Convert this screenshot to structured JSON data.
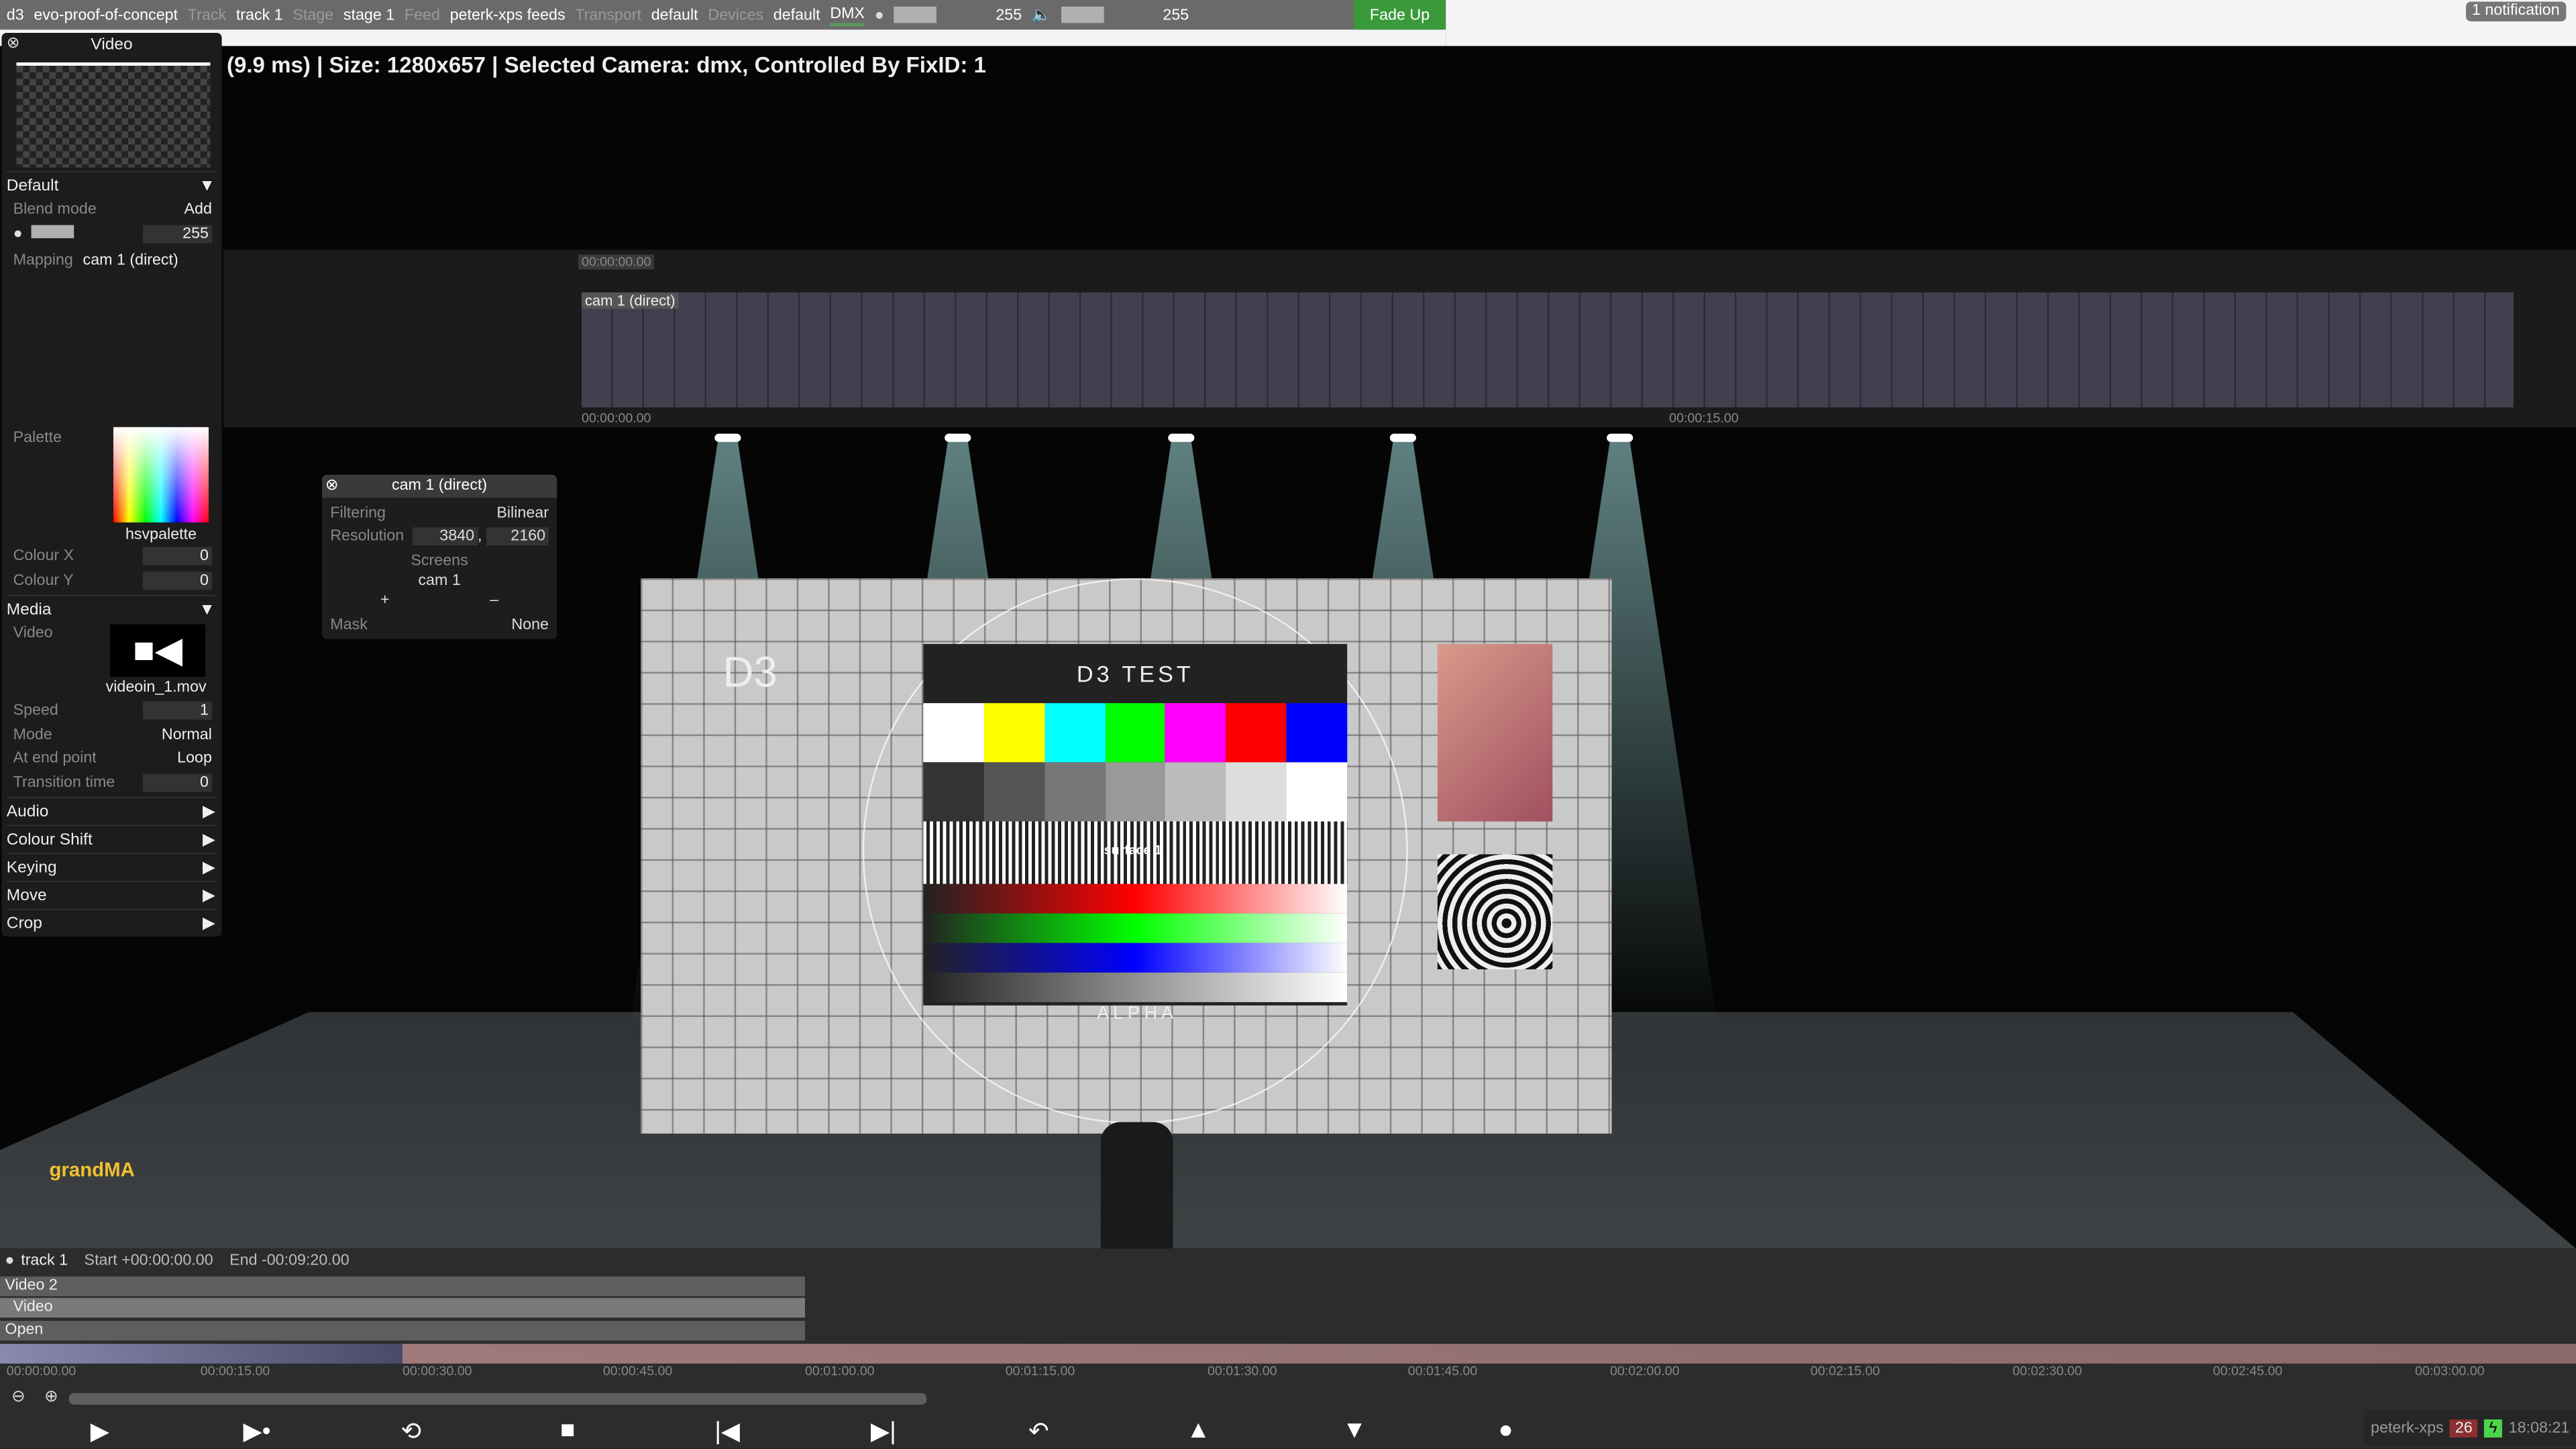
{
  "topbar": {
    "app": "d3",
    "project": "evo-proof-of-concept",
    "track_label": "Track",
    "track": "track 1",
    "stage_label": "Stage",
    "stage": "stage 1",
    "feed_label": "Feed",
    "feed": "peterk-xps feeds",
    "transport_label": "Transport",
    "transport": "default",
    "devices_label": "Devices",
    "devices": "default",
    "dmx": "DMX",
    "brightness": "255",
    "volume": "255",
    "fade_up": "Fade Up",
    "notification": "1 notification"
  },
  "status": "(9.9 ms) | Size: 1280x657 | Selected Camera:  dmx, Controlled By FixID: 1",
  "left_panel": {
    "title": "Video",
    "default_section": "Default",
    "blend_mode_label": "Blend mode",
    "blend_mode": "Add",
    "intensity": "255",
    "mapping_label": "Mapping",
    "mapping": "cam 1 (direct)",
    "palette_label": "Palette",
    "palette": "hsvpalette",
    "colour_x_label": "Colour X",
    "colour_x": "0",
    "colour_y_label": "Colour Y",
    "colour_y": "0",
    "media_section": "Media",
    "video_label": "Video",
    "video_file": "videoin_1.mov",
    "speed_label": "Speed",
    "speed": "1",
    "mode_label": "Mode",
    "mode": "Normal",
    "end_label": "At end point",
    "end": "Loop",
    "transition_label": "Transition time",
    "transition": "0",
    "sections": [
      "Audio",
      "Colour Shift",
      "Keying",
      "Move",
      "Crop"
    ]
  },
  "timeline": {
    "playhead": "00:00:00.00",
    "clip": "cam 1 (direct)",
    "start": "00:00:00.00",
    "mark": "00:00:15.00"
  },
  "cam_panel": {
    "title": "cam 1 (direct)",
    "filtering_label": "Filtering",
    "filtering": "Bilinear",
    "resolution_label": "Resolution",
    "res_w": "3840",
    "res_h": "2160",
    "screens_label": "Screens",
    "screen": "cam 1",
    "add": "+",
    "remove": "–",
    "mask_label": "Mask",
    "mask": "None"
  },
  "scene": {
    "title": "D3 TEST",
    "surface": "surface 1",
    "alpha": "A L P H A",
    "logo": "D3",
    "grandma": "grandMA"
  },
  "bottom": {
    "track": "track 1",
    "start": "Start +00:00:00.00",
    "end": "End -00:09:20.00",
    "layers": [
      "Video 2",
      "Video",
      "Open"
    ],
    "ticks": [
      "00:00:00.00",
      "00:00:15.00",
      "00:00:30.00",
      "00:00:45.00",
      "00:01:00.00",
      "00:01:15.00",
      "00:01:30.00",
      "00:01:45.00",
      "00:02:00.00",
      "00:02:15.00",
      "00:02:30.00",
      "00:02:45.00",
      "00:03:00.00"
    ],
    "machine": "peterk-xps",
    "count": "26",
    "time": "18:08:21"
  },
  "colors": {
    "accent_green": "#3a9a3a",
    "count_badge": "#8a3030",
    "power_badge": "#4cd44c"
  }
}
